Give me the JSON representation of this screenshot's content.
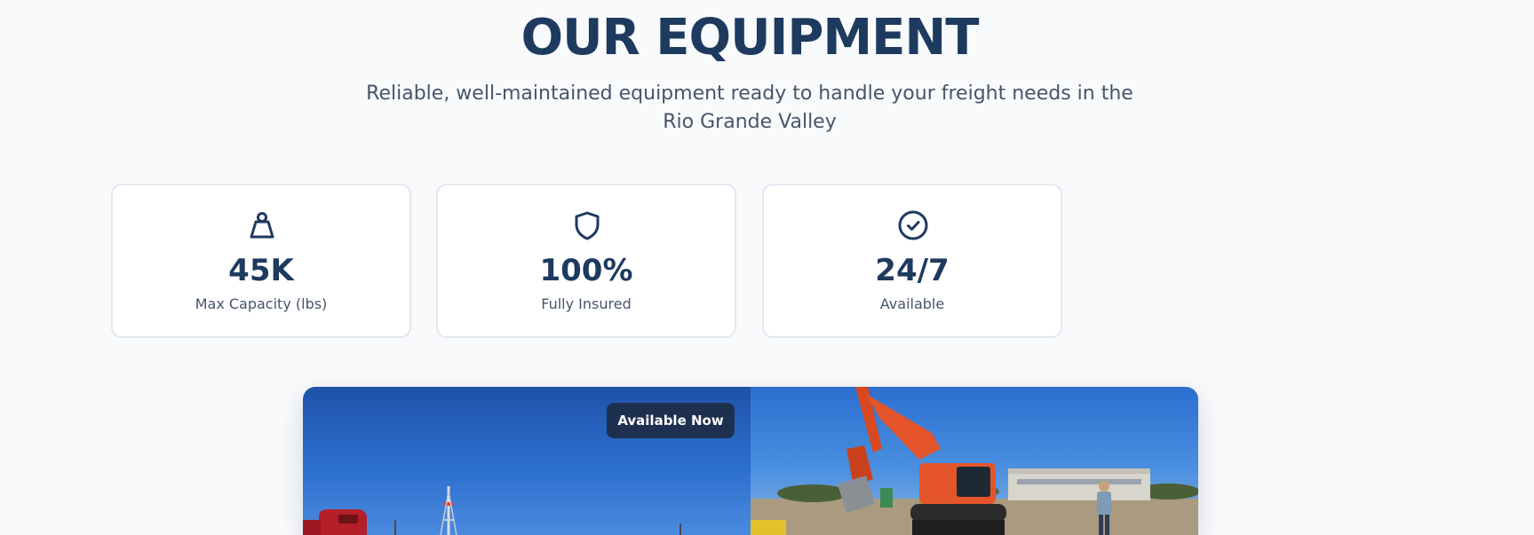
{
  "section": {
    "title": "OUR EQUIPMENT",
    "subtitle": "Reliable, well-maintained equipment ready to handle your freight needs in the Rio Grande Valley"
  },
  "stats": [
    {
      "icon": "weight-icon",
      "value": "45K",
      "label": "Max Capacity (lbs)"
    },
    {
      "icon": "shield-icon",
      "value": "100%",
      "label": "Fully Insured"
    },
    {
      "icon": "check-circle-icon",
      "value": "24/7",
      "label": "Available"
    }
  ],
  "gallery": {
    "badge": "Available Now",
    "photos": [
      {
        "subject": "red semi truck on highway under blue sky"
      },
      {
        "subject": "orange Kubota excavator at work site"
      }
    ]
  },
  "colors": {
    "primary": "#1e3a5f",
    "text_muted": "#475569",
    "background": "#f8fafc",
    "card_border": "#e2e8f0",
    "badge_bg": "#1e3050"
  }
}
